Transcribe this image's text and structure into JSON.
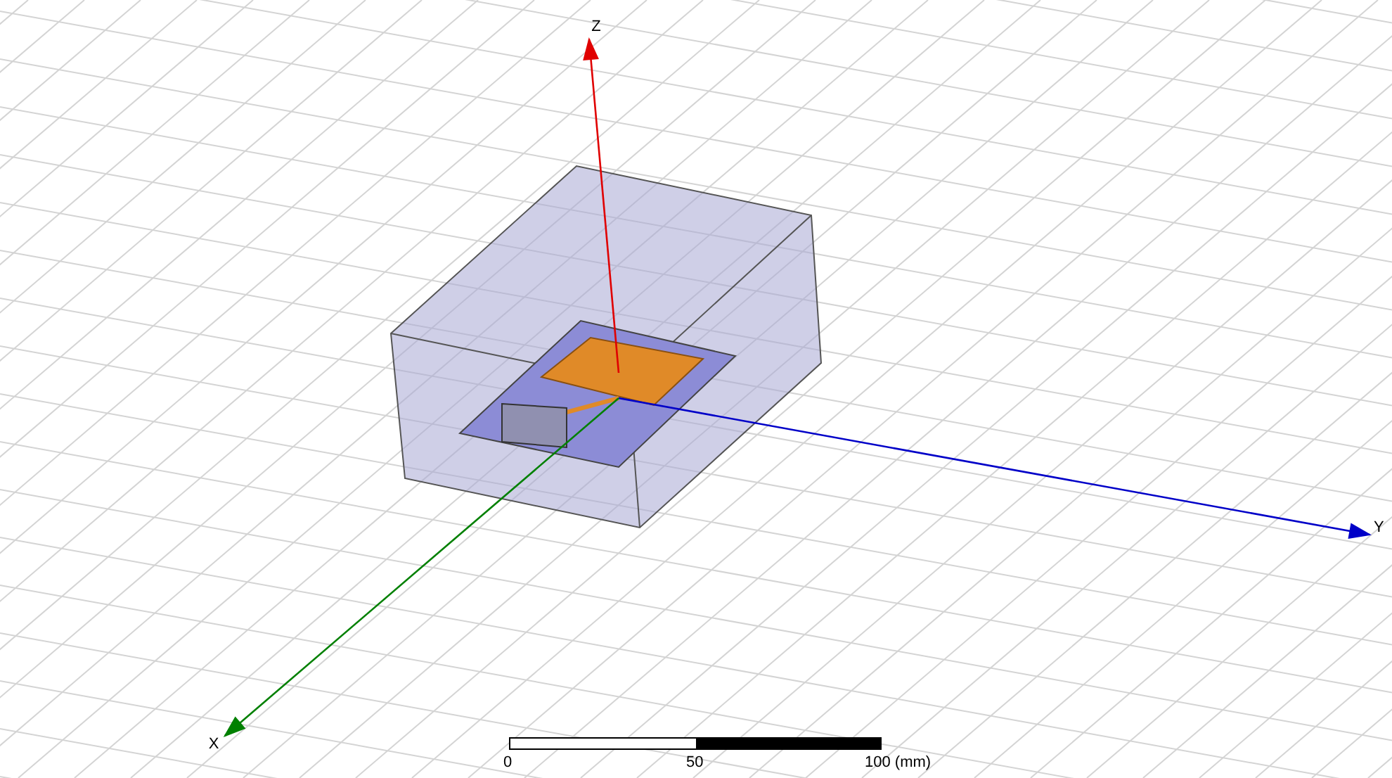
{
  "axes": [
    {
      "label": "Z",
      "color": "#e00000"
    },
    {
      "label": "Y",
      "color": "#0000c8"
    },
    {
      "label": "X",
      "color": "#008000"
    }
  ],
  "scale_bar": {
    "labels": [
      "0",
      "50",
      "100 (mm)"
    ]
  }
}
